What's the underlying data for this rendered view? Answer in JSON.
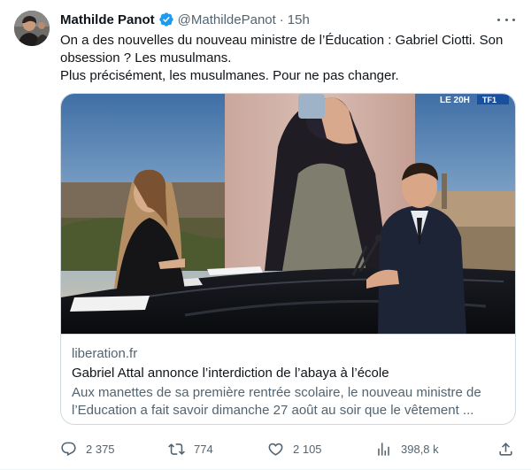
{
  "author": {
    "name": "Mathilde Panot",
    "handle": "@MathildePanot",
    "separator": "·",
    "time": "15h",
    "verified_color": "#1d9bf0"
  },
  "text": {
    "line1": "On a des nouvelles du nouveau ministre de l’Éducation : Gabriel Ciotti. Son obsession ? Les musulmans.",
    "line2": "Plus précisément, les musulmanes. Pour ne pas changer."
  },
  "card": {
    "domain": "liberation.fr",
    "title": "Gabriel Attal annonce l’interdiction de l’abaya à l’école",
    "description": "Aux manettes de sa première rentrée scolaire, le nouveau ministre de l’Education a fait savoir dimanche 27 août au soir que le vêtement ...",
    "image_watermark": "LE 20H TF1"
  },
  "actions": {
    "replies": "2 375",
    "retweets": "774",
    "likes": "2 105",
    "views": "398,8 k"
  },
  "icons": {
    "more": "more-dots-icon",
    "verified": "verified-badge-icon",
    "reply": "reply-icon",
    "retweet": "retweet-icon",
    "like": "heart-icon",
    "views": "views-chart-icon",
    "share": "share-icon"
  },
  "colors": {
    "text_primary": "#0f1419",
    "text_secondary": "#536471",
    "border": "#cfd9de",
    "accent": "#1d9bf0"
  }
}
